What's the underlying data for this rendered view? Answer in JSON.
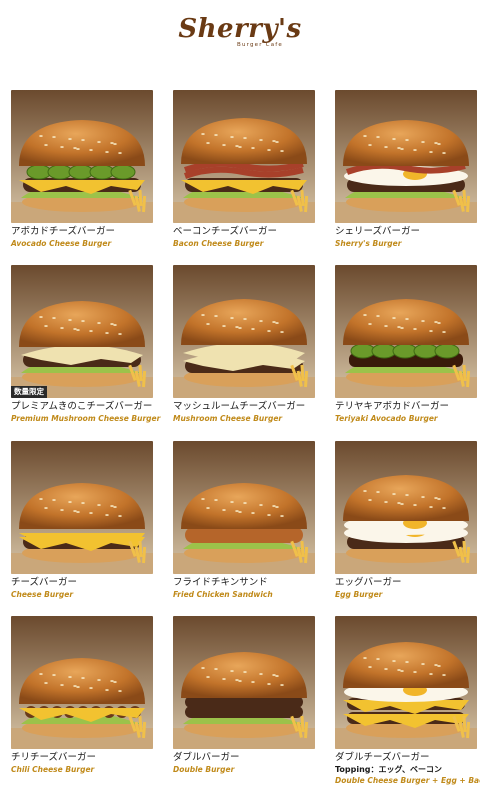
{
  "brand": {
    "name": "Sherry's",
    "tagline": "Burger Cafe"
  },
  "colors": {
    "brand": "#6a3a14",
    "accent": "#c08a1a",
    "text": "#1a1a1a"
  },
  "menu": [
    {
      "jp": "アボカドチーズバーガー",
      "en": "Avocado Cheese Burger",
      "type": "avocado"
    },
    {
      "jp": "ベーコンチーズバーガー",
      "en": "Bacon Cheese Burger",
      "type": "bacon"
    },
    {
      "jp": "シェリーズバーガー",
      "en": "Sherry's Burger",
      "type": "sherry"
    },
    {
      "jp": "プレミアムきのこチーズバーガー",
      "en": "Premium Mushroom Cheese Burger",
      "type": "premium",
      "badge": "数量限定"
    },
    {
      "jp": "マッシュルームチーズバーガー",
      "en": "Mushroom Cheese Burger",
      "type": "mushroom"
    },
    {
      "jp": "テリヤキアボカドバーガー",
      "en": "Teriyaki Avocado Burger",
      "type": "teriyaki"
    },
    {
      "jp": "チーズバーガー",
      "en": "Cheese Burger",
      "type": "cheese"
    },
    {
      "jp": "フライドチキンサンド",
      "en": "Fried Chicken Sandwich",
      "type": "chicken"
    },
    {
      "jp": "エッグバーガー",
      "en": "Egg Burger",
      "type": "egg"
    },
    {
      "jp": "チリチーズバーガー",
      "en": "Chili Cheese Burger",
      "type": "chili"
    },
    {
      "jp": "ダブルバーガー",
      "en": "Double Burger",
      "type": "double"
    },
    {
      "jp": "ダブルチーズバーガー",
      "topping": "Topping：エッグ、ベーコン",
      "en": "Double Cheese Burger + Egg + Bacon",
      "type": "doublecheese"
    }
  ]
}
